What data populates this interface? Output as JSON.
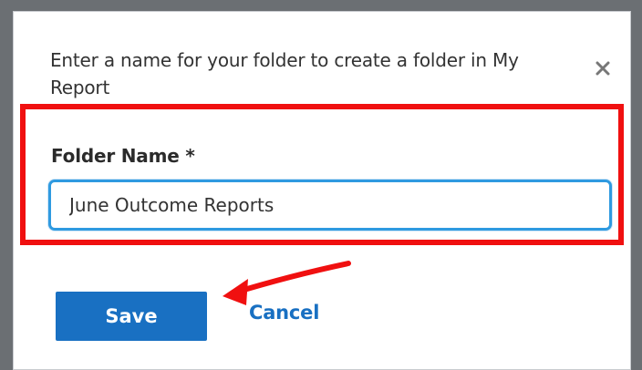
{
  "dialog": {
    "prompt": "Enter a name for your folder to create a folder in My Report",
    "close_icon": "close-icon",
    "field_label": "Folder Name *",
    "field_value": "June Outcome Reports",
    "save_label": "Save",
    "cancel_label": "Cancel"
  },
  "annotations": {
    "highlight_color": "#f01010",
    "arrow_color": "#f01010"
  },
  "colors": {
    "primary": "#1970c2",
    "input_focus": "#2f9ae0"
  }
}
